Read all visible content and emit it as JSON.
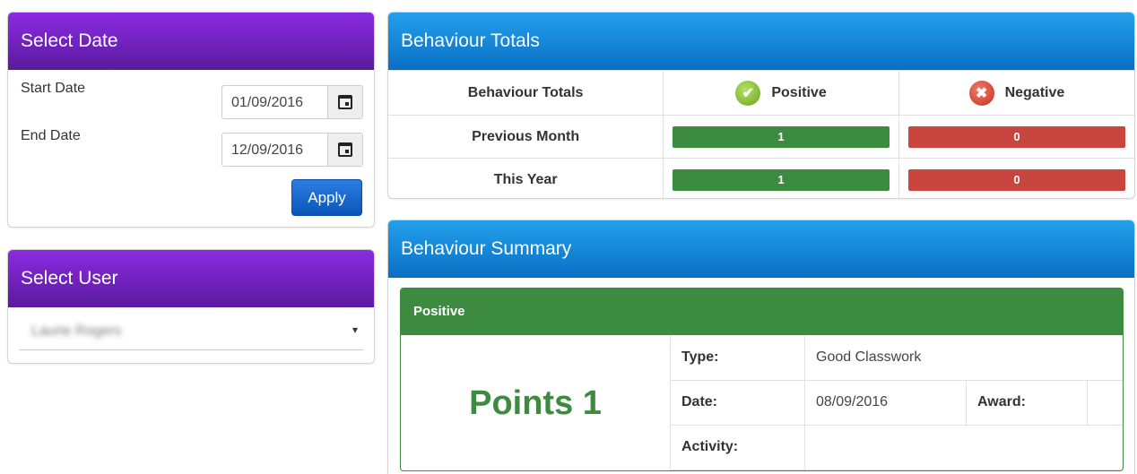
{
  "select_date": {
    "title": "Select Date",
    "start_label": "Start Date",
    "start_value": "01/09/2016",
    "end_label": "End Date",
    "end_value": "12/09/2016",
    "apply_label": "Apply",
    "calendar_icon": "calendar-icon"
  },
  "select_user": {
    "title": "Select User",
    "selected": "Laurie Rogers",
    "caret": "▾"
  },
  "totals": {
    "title": "Behaviour Totals",
    "col_label": "Behaviour Totals",
    "positive_label": "Positive",
    "negative_label": "Negative",
    "positive_icon": "check-circle-icon",
    "negative_icon": "x-circle-icon",
    "rows": [
      {
        "label": "Previous Month",
        "positive": "1",
        "negative": "0"
      },
      {
        "label": "This Year",
        "positive": "1",
        "negative": "0"
      }
    ],
    "colors": {
      "positive": "#3d8b40",
      "negative": "#c9453f"
    }
  },
  "summary": {
    "title": "Behaviour Summary",
    "card_title": "Positive",
    "points": "Points 1",
    "type_label": "Type:",
    "type_value": "Good Classwork",
    "date_label": "Date:",
    "date_value": "08/09/2016",
    "award_label": "Award:",
    "award_value": "",
    "activity_label": "Activity:",
    "activity_value": ""
  },
  "colors": {
    "purple_header": "#6f22c8",
    "blue_header": "#1787d9",
    "apply_button": "#1a68cf"
  }
}
